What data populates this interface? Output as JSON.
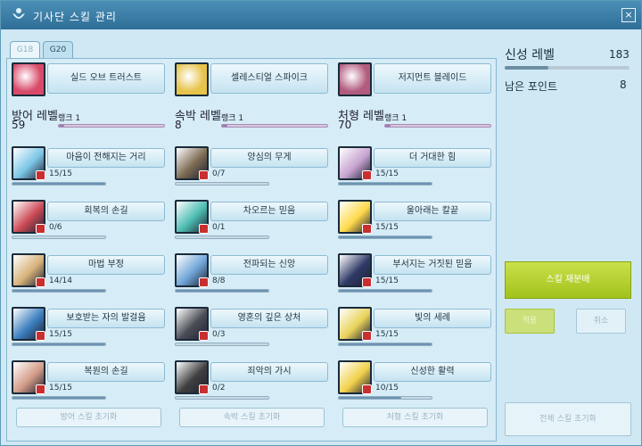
{
  "window": {
    "title": "기사단 스킬 관리",
    "close_glyph": "×"
  },
  "tabs": [
    {
      "label": "G18"
    },
    {
      "label": "G20"
    }
  ],
  "top_skills": [
    {
      "name": "실드 오브 트러스트",
      "color": "#d94a6a"
    },
    {
      "name": "셀레스티얼 스파이크",
      "color": "#e7c34a"
    },
    {
      "name": "저지먼트 블레이드",
      "color": "#b25b7e"
    }
  ],
  "categories": [
    {
      "label": "방어 레벨",
      "level": "59",
      "rank": "랭크 1",
      "progress": 0.05
    },
    {
      "label": "속박 레벨",
      "level": "8",
      "rank": "랭크 1",
      "progress": 0.05
    },
    {
      "label": "처형 레벨",
      "level": "70",
      "rank": "랭크 1",
      "progress": 0.05
    }
  ],
  "skills": [
    [
      {
        "name": "마음이 전해지는 거리",
        "count": "15/15",
        "progress": 1.0,
        "color": "#7bc6e6"
      },
      {
        "name": "회복의 손길",
        "count": "0/6",
        "progress": 0.0,
        "color": "#cc4a56"
      },
      {
        "name": "마법 부정",
        "count": "14/14",
        "progress": 1.0,
        "color": "#d7b27a"
      },
      {
        "name": "보호받는 자의 발걸음",
        "count": "15/15",
        "progress": 1.0,
        "color": "#3b7fbf"
      },
      {
        "name": "복원의 손길",
        "count": "15/15",
        "progress": 1.0,
        "color": "#d39c88"
      }
    ],
    [
      {
        "name": "양심의 무게",
        "count": "0/7",
        "progress": 0.0,
        "color": "#7b6a52"
      },
      {
        "name": "차오르는 믿음",
        "count": "0/1",
        "progress": 0.0,
        "color": "#4bbcb2"
      },
      {
        "name": "전파되는 신앙",
        "count": "8/8",
        "progress": 1.0,
        "color": "#6fa5d7"
      },
      {
        "name": "영혼의 깊은 상처",
        "count": "0/3",
        "progress": 0.0,
        "color": "#4a4d56"
      },
      {
        "name": "죄악의 가시",
        "count": "0/2",
        "progress": 0.0,
        "color": "#3f3f3f"
      }
    ],
    [
      {
        "name": "더 거대한 힘",
        "count": "15/15",
        "progress": 1.0,
        "color": "#c7a4d1"
      },
      {
        "name": "울아래는 칼끝",
        "count": "15/15",
        "progress": 1.0,
        "color": "#ffd94a"
      },
      {
        "name": "부서지는 거짓된 믿음",
        "count": "15/15",
        "progress": 1.0,
        "color": "#2f3a66"
      },
      {
        "name": "빛의 세례",
        "count": "15/15",
        "progress": 1.0,
        "color": "#e9d35a"
      },
      {
        "name": "신성한 활력",
        "count": "10/15",
        "progress": 0.67,
        "color": "#f2d14a"
      }
    ]
  ],
  "reset_buttons": [
    {
      "label": "방어 스킬 초기화"
    },
    {
      "label": "속박 스킬 초기화"
    },
    {
      "label": "처형 스킬 초기화"
    }
  ],
  "right": {
    "holy_level_label": "신성 레벨",
    "holy_level_value": "183",
    "holy_level_progress": 0.35,
    "points_label": "남은 포인트",
    "points_value": "8",
    "redistribute_label": "스킬 재분배",
    "apply_label": "적용",
    "cancel_label": "취소",
    "full_reset_label": "전체 스킬 초기화"
  },
  "colors": {
    "accent": "#a2c21c",
    "bar_fill": "#9b7bb0",
    "title_bg": "#2f6f97"
  }
}
